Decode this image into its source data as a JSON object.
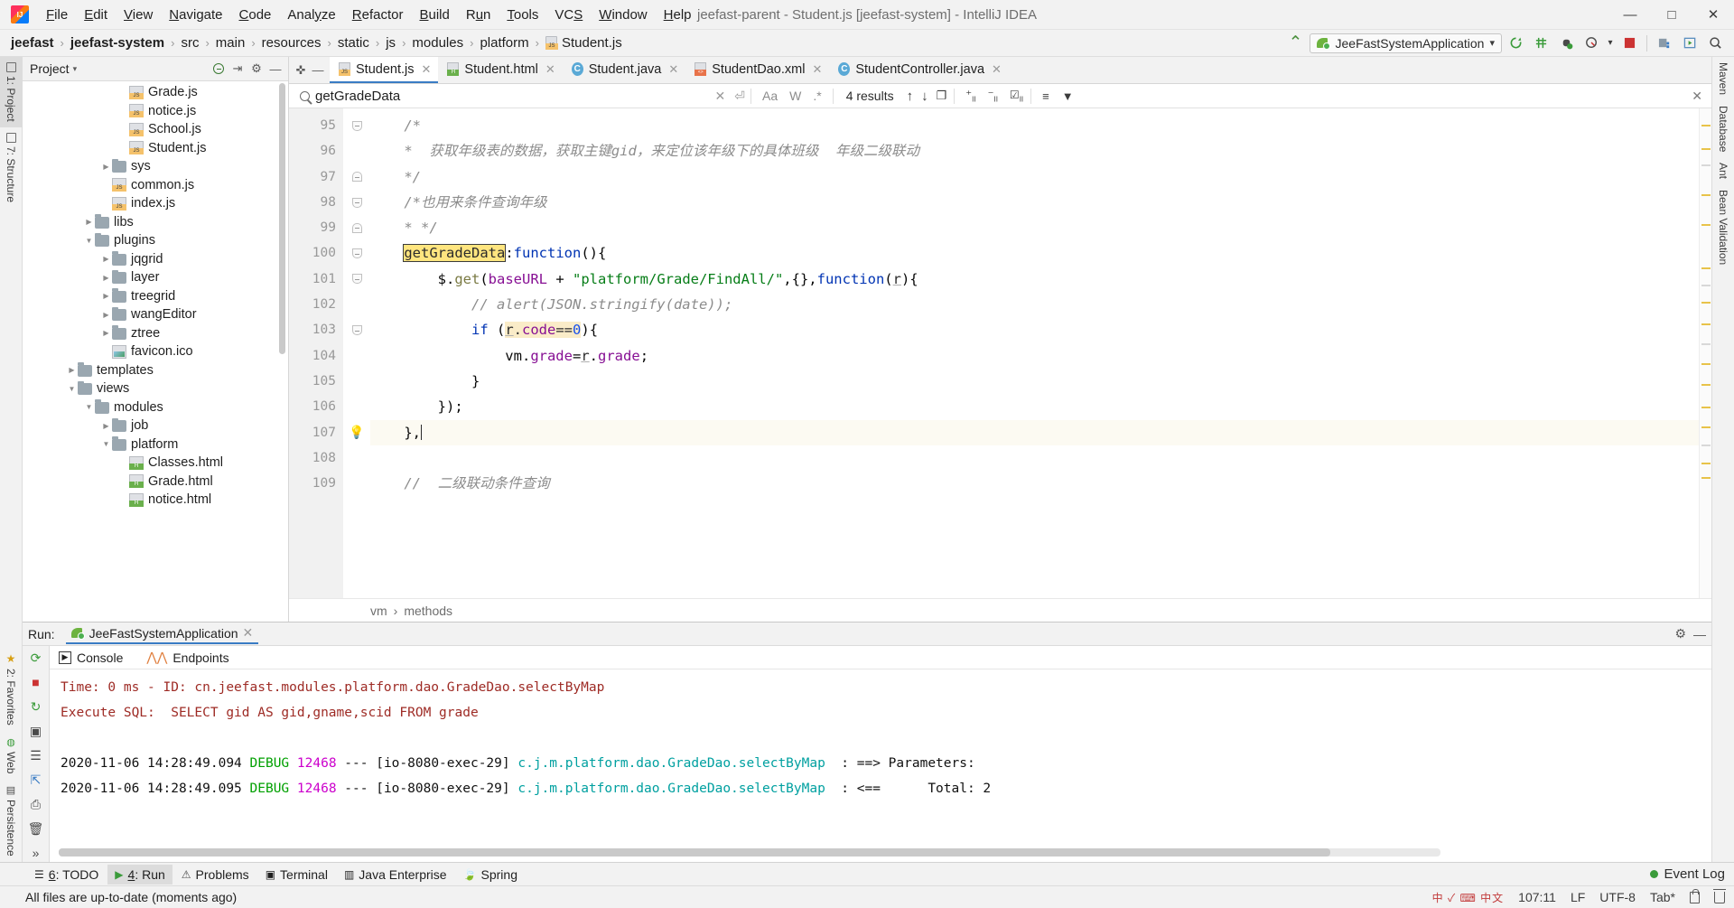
{
  "window": {
    "title": "jeefast-parent - Student.js [jeefast-system] - IntelliJ IDEA",
    "minimize": "—",
    "maximize": "□",
    "close": "✕"
  },
  "menu": [
    {
      "label": "File",
      "mnemonic": "F"
    },
    {
      "label": "Edit",
      "mnemonic": "E"
    },
    {
      "label": "View",
      "mnemonic": "V"
    },
    {
      "label": "Navigate",
      "mnemonic": "N"
    },
    {
      "label": "Code",
      "mnemonic": "C"
    },
    {
      "label": "Analyze",
      "mnemonic": "y"
    },
    {
      "label": "Refactor",
      "mnemonic": "R"
    },
    {
      "label": "Build",
      "mnemonic": "B"
    },
    {
      "label": "Run",
      "mnemonic": "u"
    },
    {
      "label": "Tools",
      "mnemonic": "T"
    },
    {
      "label": "VCS",
      "mnemonic": "S"
    },
    {
      "label": "Window",
      "mnemonic": "W"
    },
    {
      "label": "Help",
      "mnemonic": "H"
    }
  ],
  "breadcrumbs": [
    {
      "label": "jeefast",
      "bold": true,
      "icon": null
    },
    {
      "label": "jeefast-system",
      "bold": true,
      "icon": null
    },
    {
      "label": "src",
      "bold": false,
      "icon": null
    },
    {
      "label": "main",
      "bold": false,
      "icon": null
    },
    {
      "label": "resources",
      "bold": false,
      "icon": null
    },
    {
      "label": "static",
      "bold": false,
      "icon": null
    },
    {
      "label": "js",
      "bold": false,
      "icon": null
    },
    {
      "label": "modules",
      "bold": false,
      "icon": null
    },
    {
      "label": "platform",
      "bold": false,
      "icon": null
    },
    {
      "label": "Student.js",
      "bold": false,
      "icon": "js"
    }
  ],
  "toolbar": {
    "run_config": "JeeFastSystemApplication",
    "dropdown_caret": "▾",
    "build_hammer": "⌃",
    "icons": [
      "rerun-icon",
      "build-icon",
      "debug-icon",
      "coverage-icon",
      "stop-icon",
      "project-structure-icon",
      "select-in-icon",
      "search-everywhere-icon"
    ]
  },
  "project_panel": {
    "title": "Project",
    "caret": "▾",
    "actions": [
      "locate-icon",
      "collapse-all-icon",
      "settings-icon",
      "hide-icon"
    ],
    "tree": [
      {
        "indent": 5,
        "arrow": "",
        "icon": "js",
        "label": "Grade.js"
      },
      {
        "indent": 5,
        "arrow": "",
        "icon": "js",
        "label": "notice.js"
      },
      {
        "indent": 5,
        "arrow": "",
        "icon": "js",
        "label": "School.js"
      },
      {
        "indent": 5,
        "arrow": "",
        "icon": "js",
        "label": "Student.js"
      },
      {
        "indent": 4,
        "arrow": "▶",
        "icon": "folder",
        "label": "sys"
      },
      {
        "indent": 4,
        "arrow": "",
        "icon": "js",
        "label": "common.js"
      },
      {
        "indent": 4,
        "arrow": "",
        "icon": "js",
        "label": "index.js"
      },
      {
        "indent": 3,
        "arrow": "▶",
        "icon": "folder",
        "label": "libs"
      },
      {
        "indent": 3,
        "arrow": "▼",
        "icon": "folder",
        "label": "plugins"
      },
      {
        "indent": 4,
        "arrow": "▶",
        "icon": "folder",
        "label": "jqgrid"
      },
      {
        "indent": 4,
        "arrow": "▶",
        "icon": "folder",
        "label": "layer"
      },
      {
        "indent": 4,
        "arrow": "▶",
        "icon": "folder",
        "label": "treegrid"
      },
      {
        "indent": 4,
        "arrow": "▶",
        "icon": "folder",
        "label": "wangEditor"
      },
      {
        "indent": 4,
        "arrow": "▶",
        "icon": "folder",
        "label": "ztree"
      },
      {
        "indent": 4,
        "arrow": "",
        "icon": "ico",
        "label": "favicon.ico"
      },
      {
        "indent": 2,
        "arrow": "▶",
        "icon": "folder",
        "label": "templates"
      },
      {
        "indent": 2,
        "arrow": "▼",
        "icon": "folder",
        "label": "views"
      },
      {
        "indent": 3,
        "arrow": "▼",
        "icon": "folder",
        "label": "modules"
      },
      {
        "indent": 4,
        "arrow": "▶",
        "icon": "folder",
        "label": "job"
      },
      {
        "indent": 4,
        "arrow": "▼",
        "icon": "folder",
        "label": "platform"
      },
      {
        "indent": 5,
        "arrow": "",
        "icon": "html",
        "label": "Classes.html"
      },
      {
        "indent": 5,
        "arrow": "",
        "icon": "html",
        "label": "Grade.html"
      },
      {
        "indent": 5,
        "arrow": "",
        "icon": "html",
        "label": "notice.html"
      }
    ]
  },
  "editor_tabs": [
    {
      "label": "Student.js",
      "icon": "js",
      "active": true,
      "close": "✕"
    },
    {
      "label": "Student.html",
      "icon": "html",
      "active": false,
      "close": "✕"
    },
    {
      "label": "Student.java",
      "icon": "java",
      "active": false,
      "close": "✕"
    },
    {
      "label": "StudentDao.xml",
      "icon": "xml",
      "active": false,
      "close": "✕"
    },
    {
      "label": "StudentController.java",
      "icon": "java",
      "active": false,
      "close": "✕"
    }
  ],
  "find_bar": {
    "query": "getGradeData",
    "placeholder": "Find",
    "results": "4 results",
    "options": [
      "Aa",
      "W",
      ".*"
    ],
    "clear": "✕",
    "history": "⏎",
    "close": "✕",
    "nav_prev": "↑",
    "nav_next": "↓"
  },
  "code": {
    "first_line": 95,
    "lines": [
      {
        "n": 95,
        "fold": "down",
        "bulb": false,
        "cur": false,
        "tokens": [
          {
            "t": "    ",
            "c": "plain"
          },
          {
            "t": "/*",
            "c": "cmt"
          }
        ]
      },
      {
        "n": 96,
        "fold": "",
        "bulb": false,
        "cur": false,
        "tokens": [
          {
            "t": "    ",
            "c": "plain"
          },
          {
            "t": "*  获取年级表的数据，获取主键gid，来定位该年级下的具体班级  年级二级联动",
            "c": "cmt"
          }
        ]
      },
      {
        "n": 97,
        "fold": "up",
        "bulb": false,
        "cur": false,
        "tokens": [
          {
            "t": "    ",
            "c": "plain"
          },
          {
            "t": "*/",
            "c": "cmt"
          }
        ]
      },
      {
        "n": 98,
        "fold": "down",
        "bulb": false,
        "cur": false,
        "tokens": [
          {
            "t": "    ",
            "c": "plain"
          },
          {
            "t": "/*也用来条件查询年级",
            "c": "cmt"
          }
        ]
      },
      {
        "n": 99,
        "fold": "up",
        "bulb": false,
        "cur": false,
        "tokens": [
          {
            "t": "    ",
            "c": "plain"
          },
          {
            "t": "* */",
            "c": "cmt"
          }
        ]
      },
      {
        "n": 100,
        "fold": "down",
        "bulb": false,
        "cur": false,
        "tokens": [
          {
            "t": "    ",
            "c": "plain"
          },
          {
            "t": "getGradeData",
            "c": "hl"
          },
          {
            "t": ":",
            "c": "plain"
          },
          {
            "t": "function",
            "c": "kw"
          },
          {
            "t": "(){",
            "c": "plain"
          }
        ]
      },
      {
        "n": 101,
        "fold": "down",
        "bulb": false,
        "cur": false,
        "tokens": [
          {
            "t": "        $.",
            "c": "plain"
          },
          {
            "t": "get",
            "c": "fn"
          },
          {
            "t": "(",
            "c": "plain"
          },
          {
            "t": "baseURL",
            "c": "fld"
          },
          {
            "t": " + ",
            "c": "plain"
          },
          {
            "t": "\"platform/Grade/FindAll/\"",
            "c": "str"
          },
          {
            "t": ",{},",
            "c": "plain"
          },
          {
            "t": "function",
            "c": "kw"
          },
          {
            "t": "(",
            "c": "plain"
          },
          {
            "t": "r",
            "c": "undl"
          },
          {
            "t": "){",
            "c": "plain"
          }
        ]
      },
      {
        "n": 102,
        "fold": "",
        "bulb": false,
        "cur": false,
        "tokens": [
          {
            "t": "            ",
            "c": "plain"
          },
          {
            "t": "// alert(JSON.stringify(date));",
            "c": "cmt"
          }
        ]
      },
      {
        "n": 103,
        "fold": "down",
        "bulb": false,
        "cur": false,
        "tokens": [
          {
            "t": "            ",
            "c": "plain"
          },
          {
            "t": "if",
            "c": "kw"
          },
          {
            "t": " (",
            "c": "plain"
          },
          {
            "t": "r",
            "c": "hl2undl"
          },
          {
            "t": ".",
            "c": "hl2"
          },
          {
            "t": "code",
            "c": "hl2fld"
          },
          {
            "t": "==",
            "c": "hl2"
          },
          {
            "t": "0",
            "c": "hl2num"
          },
          {
            "t": "){",
            "c": "plain"
          }
        ]
      },
      {
        "n": 104,
        "fold": "",
        "bulb": false,
        "cur": false,
        "tokens": [
          {
            "t": "                vm.",
            "c": "plain"
          },
          {
            "t": "grade",
            "c": "fld"
          },
          {
            "t": "=",
            "c": "plain"
          },
          {
            "t": "r",
            "c": "undl"
          },
          {
            "t": ".",
            "c": "plain"
          },
          {
            "t": "grade",
            "c": "fld"
          },
          {
            "t": ";",
            "c": "plain"
          }
        ]
      },
      {
        "n": 105,
        "fold": "",
        "bulb": false,
        "cur": false,
        "tokens": [
          {
            "t": "            }",
            "c": "plain"
          }
        ]
      },
      {
        "n": 106,
        "fold": "",
        "bulb": false,
        "cur": false,
        "tokens": [
          {
            "t": "        });",
            "c": "plain"
          }
        ]
      },
      {
        "n": 107,
        "fold": "up",
        "bulb": true,
        "cur": true,
        "tokens": [
          {
            "t": "    },",
            "c": "plain"
          },
          {
            "t": "|",
            "c": "caret"
          }
        ]
      },
      {
        "n": 108,
        "fold": "",
        "bulb": false,
        "cur": false,
        "tokens": [
          {
            "t": "",
            "c": "plain"
          }
        ]
      },
      {
        "n": 109,
        "fold": "",
        "bulb": false,
        "cur": false,
        "tokens": [
          {
            "t": "    ",
            "c": "plain"
          },
          {
            "t": "//  二级联动条件查询",
            "c": "cmt"
          }
        ]
      }
    ],
    "breadcrumb": [
      "vm",
      "methods"
    ],
    "breadcrumb_sep": "›"
  },
  "run_panel": {
    "label": "Run:",
    "config_name": "JeeFastSystemApplication",
    "close": "✕",
    "settings_icon": "gear-icon",
    "hide_icon": "—",
    "tabs": [
      {
        "label": "Console",
        "icon": "console-icon"
      },
      {
        "label": "Endpoints",
        "icon": "endpoints-icon"
      }
    ],
    "console_lines": [
      {
        "segments": [
          {
            "t": "Time: 0 ms - ID: cn.jeefast.modules.platform.dao.GradeDao.selectByMap",
            "c": "c-red"
          }
        ]
      },
      {
        "segments": [
          {
            "t": "Execute SQL:  SELECT gid AS gid,gname,scid FROM grade",
            "c": "c-red"
          }
        ]
      },
      {
        "segments": [
          {
            "t": "",
            "c": "c-black"
          }
        ]
      },
      {
        "segments": [
          {
            "t": "2020-11-06 14:28:49.094 ",
            "c": "c-black"
          },
          {
            "t": "DEBUG",
            "c": "c-green"
          },
          {
            "t": " ",
            "c": "c-black"
          },
          {
            "t": "12468",
            "c": "c-mag"
          },
          {
            "t": " --- [io-8080-exec-29] ",
            "c": "c-black"
          },
          {
            "t": "c.j.m.platform.dao.GradeDao.selectByMap",
            "c": "c-cyan"
          },
          {
            "t": "  : ==> Parameters:",
            "c": "c-black"
          }
        ]
      },
      {
        "segments": [
          {
            "t": "2020-11-06 14:28:49.095 ",
            "c": "c-black"
          },
          {
            "t": "DEBUG",
            "c": "c-green"
          },
          {
            "t": " ",
            "c": "c-black"
          },
          {
            "t": "12468",
            "c": "c-mag"
          },
          {
            "t": " --- [io-8080-exec-29] ",
            "c": "c-black"
          },
          {
            "t": "c.j.m.platform.dao.GradeDao.selectByMap",
            "c": "c-cyan"
          },
          {
            "t": "  : <==      Total: 2",
            "c": "c-black"
          }
        ]
      }
    ]
  },
  "bottom_bar": {
    "items": [
      {
        "label": "6: TODO",
        "mnemonic": "6",
        "icon": "todo-icon",
        "active": false
      },
      {
        "label": "4: Run",
        "mnemonic": "4",
        "icon": "run-icon",
        "active": true
      },
      {
        "label": "Problems",
        "mnemonic": "",
        "icon": "problems-icon",
        "active": false
      },
      {
        "label": "Terminal",
        "mnemonic": "",
        "icon": "terminal-icon",
        "active": false
      },
      {
        "label": "Java Enterprise",
        "mnemonic": "",
        "icon": "java-enterprise-icon",
        "active": false
      },
      {
        "label": "Spring",
        "mnemonic": "",
        "icon": "spring-icon",
        "active": false
      }
    ],
    "event_log": "Event Log"
  },
  "left_rail": {
    "top": [
      "1: Project",
      "7: Structure"
    ],
    "bottom": [
      "2: Favorites",
      "Web",
      "Persistence"
    ]
  },
  "right_rail": {
    "items": [
      "Maven",
      "Database",
      "Ant",
      "Bean Validation"
    ]
  },
  "status_bar": {
    "message": "All files are up-to-date (moments ago)",
    "caret_position": "107:11",
    "line_separator": "LF",
    "encoding": "UTF-8",
    "indent": "Tab*",
    "ime": "中 ✓ ⌨ 中文"
  },
  "colors": {
    "accent_blue": "#3a7cc4",
    "highlight_yellow": "#ffe57f",
    "soft_highlight": "#faecc8",
    "string_green": "#067d17",
    "keyword_blue": "#0033b3",
    "field_purple": "#871094",
    "comment_gray": "#8c8c8c",
    "console_red": "#9e2b25",
    "debug_green": "#00a000",
    "pid_magenta": "#cc00cc",
    "logger_cyan": "#00a0a0",
    "run_green": "#4a8f3c",
    "stop_red": "#cc3333"
  }
}
